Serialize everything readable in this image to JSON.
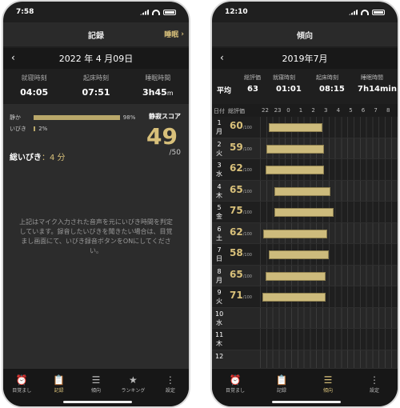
{
  "left": {
    "status_time": "7:58",
    "nav_title": "記録",
    "nav_right": "睡眠",
    "date": "2022 年 4 月09日",
    "summary": [
      {
        "label": "就寝時刻",
        "value": "04:05",
        "unit": ""
      },
      {
        "label": "起床時刻",
        "value": "07:51",
        "unit": ""
      },
      {
        "label": "睡眠時間",
        "value": "3h45",
        "unit": "m"
      }
    ],
    "levels": [
      {
        "name": "静か",
        "pct": "98%",
        "fraction": 0.98
      },
      {
        "name": "いびき",
        "pct": "2%",
        "fraction": 0.02
      }
    ],
    "score_label": "静寂スコア",
    "score": "49",
    "score_max": "/50",
    "snore_total_label": "総いびき",
    "snore_total_value": "：4 分",
    "notice": "上記はマイク入力された音声を元にいびき時間を判定しています。録音したいびきを聞きたい場合は、目覚まし画面にて、いびき録音ボタンをONにしてください。",
    "tabs": [
      {
        "label": "目覚まし",
        "icon": "alarm-icon",
        "glyph": "⏰",
        "active": false
      },
      {
        "label": "記録",
        "icon": "clipboard-icon",
        "glyph": "📋",
        "active": true
      },
      {
        "label": "傾向",
        "icon": "list-icon",
        "glyph": "☰",
        "active": false
      },
      {
        "label": "ランキング",
        "icon": "star-icon",
        "glyph": "★",
        "active": false
      },
      {
        "label": "設定",
        "icon": "more-icon",
        "glyph": "⋮",
        "active": false
      }
    ]
  },
  "right": {
    "status_time": "12:10",
    "nav_title": "傾向",
    "month": "2019年7月",
    "summary_headers": [
      "総評価",
      "就寝時刻",
      "起床時刻",
      "睡眠時間"
    ],
    "avg_label": "平均",
    "summary_values": [
      "63",
      "01:01",
      "08:15",
      "7h14min"
    ],
    "grid_header": {
      "day": "日付",
      "score": "総評価",
      "hours": [
        "22",
        "23",
        "0",
        "1",
        "2",
        "3",
        "4",
        "5",
        "6",
        "7",
        "8",
        "9"
      ]
    },
    "rows": [
      {
        "day": "1",
        "wd": "月",
        "score": "60",
        "unit": "/100",
        "start": 1.1,
        "end": 9.8
      },
      {
        "day": "2",
        "wd": "火",
        "score": "59",
        "unit": "/100",
        "start": 0.8,
        "end": 10.0
      },
      {
        "day": "3",
        "wd": "水",
        "score": "62",
        "unit": "/100",
        "start": 0.6,
        "end": 10.0
      },
      {
        "day": "4",
        "wd": "木",
        "score": "65",
        "unit": "/100",
        "start": 2.0,
        "end": 11.0
      },
      {
        "day": "5",
        "wd": "金",
        "score": "75",
        "unit": "/100",
        "start": 2.1,
        "end": 11.5
      },
      {
        "day": "6",
        "wd": "土",
        "score": "62",
        "unit": "/100",
        "start": 0.3,
        "end": 10.5
      },
      {
        "day": "7",
        "wd": "日",
        "score": "58",
        "unit": "/100",
        "start": 1.2,
        "end": 10.8
      },
      {
        "day": "8",
        "wd": "月",
        "score": "65",
        "unit": "/100",
        "start": 0.7,
        "end": 10.3
      },
      {
        "day": "9",
        "wd": "火",
        "score": "71",
        "unit": "/100",
        "start": 0.1,
        "end": 10.2
      },
      {
        "day": "10",
        "wd": "水",
        "score": "",
        "unit": "",
        "start": null,
        "end": null
      },
      {
        "day": "11",
        "wd": "木",
        "score": "",
        "unit": "",
        "start": null,
        "end": null
      },
      {
        "day": "12",
        "wd": "",
        "score": "",
        "unit": "",
        "start": null,
        "end": null
      }
    ],
    "tabs": [
      {
        "label": "目覚まし",
        "icon": "alarm-icon",
        "glyph": "⏰",
        "active": false
      },
      {
        "label": "記録",
        "icon": "clipboard-icon",
        "glyph": "📋",
        "active": false
      },
      {
        "label": "傾向",
        "icon": "list-icon",
        "glyph": "☰",
        "active": true
      },
      {
        "label": "設定",
        "icon": "more-icon",
        "glyph": "⋮",
        "active": false
      }
    ]
  },
  "colors": {
    "accent": "#d8c07a",
    "background": "#1f1f1f"
  }
}
